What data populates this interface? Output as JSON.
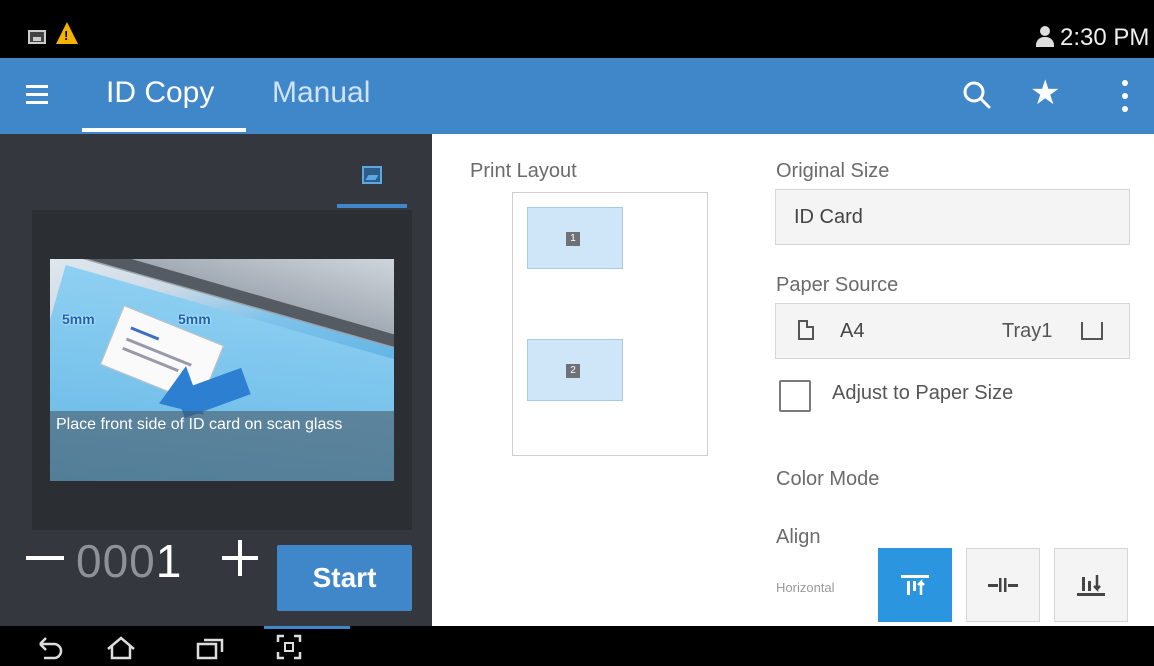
{
  "status_bar": {
    "time": "2:30 PM",
    "icons": [
      "image-icon",
      "warning-icon",
      "user-icon"
    ]
  },
  "app_bar": {
    "tabs": [
      {
        "label": "ID Copy",
        "active": true
      },
      {
        "label": "Manual",
        "active": false
      }
    ],
    "icons": [
      "menu-icon",
      "search-icon",
      "star-icon",
      "more-vertical-icon"
    ],
    "accent": "#3f87c9"
  },
  "preview": {
    "caption": "Place front side of ID card on scan glass",
    "margin_left": "5mm",
    "margin_right": "5mm"
  },
  "copies": {
    "leading": "000",
    "last_digit": "1"
  },
  "start_label": "Start",
  "settings": {
    "print_layout": {
      "label": "Print Layout",
      "slots": [
        "1",
        "2"
      ]
    },
    "original_size": {
      "label": "Original Size",
      "value": "ID Card"
    },
    "paper_source": {
      "label": "Paper Source",
      "paper": "A4",
      "tray": "Tray1"
    },
    "adjust_to_paper": {
      "label": "Adjust to Paper Size",
      "checked": false
    },
    "color_mode": {
      "label": "Color Mode"
    },
    "align": {
      "label": "Align",
      "orientation": "Horizontal",
      "options": [
        "align-top-icon",
        "align-center-icon",
        "align-bottom-icon"
      ],
      "selected": "align-top-icon"
    }
  },
  "nav_bar": {
    "icons": [
      "back-icon",
      "home-icon",
      "recent-apps-icon",
      "screen-capture-icon"
    ]
  }
}
